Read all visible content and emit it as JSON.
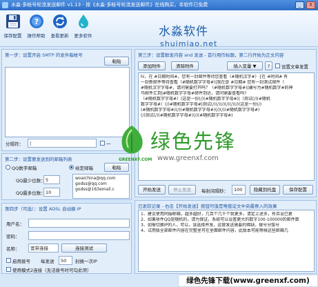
{
  "window": {
    "title": "水淼·多帐号轮流发送邮件 v1.13 - 按《水淼·多帐号轮流发送邮件》在线购买，本软件已免费",
    "minimize": "_",
    "close": "X"
  },
  "toolbar": {
    "items": [
      {
        "label": "保存配置",
        "icon": "floppy-disk-icon"
      },
      {
        "label": "操作帮助",
        "icon": "help-icon"
      },
      {
        "label": "查看更新",
        "icon": "update-icon"
      },
      {
        "label": "更多软件",
        "icon": "water-drop-icon"
      }
    ],
    "brand_cn": "水淼软件",
    "brand_en": "shuimiao.net"
  },
  "step1": {
    "title": "第一步：设置开启 SMTP 的发件箱帐号",
    "paste_label": "粘贴",
    "separator_label": "分隔符：",
    "separator_value": "|",
    "sep_hint": "一"
  },
  "step2": {
    "title": "第二步：设置要发送到的邮箱列表",
    "radio_qq": "QQ数字邮箱",
    "radio_given": "给定邮箱",
    "paste_label": "粘贴",
    "min_label": "QQ最少位数：",
    "min_value": "5",
    "max_label": "QQ最多位数：",
    "max_value": "10",
    "emails": [
      "woaichina@qq.com",
      "godss@qq.com",
      "godss@163email.c"
    ]
  },
  "step4": {
    "title": "第四步（可选）：设置 ADSL 自动换 IP",
    "user_label": "用户名：",
    "password_label": "密码：",
    "name_label": "名称：",
    "name_value": "宽带连接",
    "test_btn": "连接测试",
    "enable_label": "启用拨号",
    "every_label": "每发送",
    "every_value": "50",
    "switch_label": "封换一次IP",
    "mode_label": "使用模式2连接（无法拨号时可勾此项）"
  },
  "step3": {
    "title": "第三步：设置群发内容 and 发送 - 首行用作标题，第二行开始为正文内容",
    "add_attach": "添加附件",
    "clear_attach": "清除附件",
    "insert_var": "插入变量",
    "insert_arrow": "▼",
    "help_q": "?",
    "html_label": "设置文章发置",
    "content_lines": [
      "hi，在 #日期时间#，您有一封邮件等待您查看（#随机汉字#）{在 #时间# 有",
      "一封新邮件等待查看（#随机数字字母#)|我在是 #日期# 您有一封测试邮件（",
      "#随机汉字字母#，请问需要打开吗？（#随机数字字母#)|编号为#随机数字#的神",
      "马邮件汇到|#随机数字字母#邮件到达，请问需要查看吗?",
      "（#随机数字字母#）(这是一份(/)(#随机数字字母#)|（测试(/)(#随机",
      "数字字母#）(/)#随机数字字母#|测试(/)(/)(/)(/)(/)(/)(这是一份(/)",
      "(#随机数字字母#)(/)(#随机数字字母#)(/)(/)(#随机数字字母#)",
      "(/)测试(/)(#随机数字字母#)(/)(#随机数字字母#)"
    ],
    "start_btn": "开始发送",
    "stop_btn": "停止发送",
    "interval_label": "每封间隔秒：",
    "interval_value": "100",
    "tray_btn": "隐藏到托盘",
    "save_btn": "保存配置"
  },
  "log": {
    "title": "已发较记录 - 右击【开始发送】按钮可值是唯我证文中央最察入的效果",
    "lines": [
      "1、建议使用同服邮箱，越多越好，几百个几千个就更多，请定上述多，有且设已更",
      "2、如果收件QQ是随机的，请为保证，系统可以设置更大的数字100-100000的邮件数",
      "3、如需切换IP的人，可以，该选择并发，运营发送需要的稀缺，拨号分拔号",
      "4、试用版全部邮件内容在完整里可在里面邮件内容，此版本可能等候这些邮箱几"
    ]
  },
  "watermark": {
    "logo_text": "GREENXF.COM",
    "cn": "绿色先锋",
    "url": "www.greenxf.com"
  },
  "footer": {
    "text": "绿色先锋下载(www.greenxf.com)"
  }
}
